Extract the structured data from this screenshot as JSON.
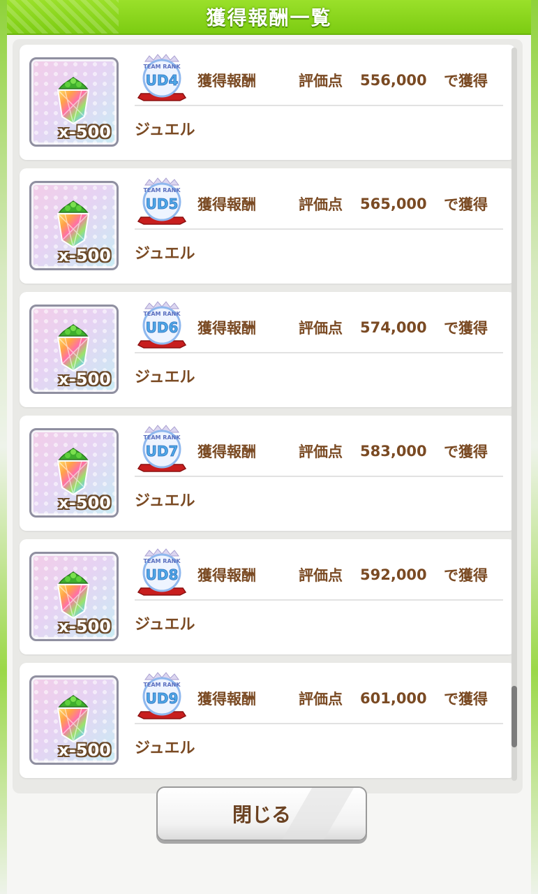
{
  "header": {
    "title": "獲得報酬一覧"
  },
  "rewards": [
    {
      "rank": "UD4",
      "badge_top": "TEAM RANK",
      "reward_label": "獲得報酬",
      "score_label": "評価点",
      "score": "556,000",
      "suffix": "で獲得",
      "item_name": "ジュエル",
      "qty": "x-500"
    },
    {
      "rank": "UD5",
      "badge_top": "TEAM RANK",
      "reward_label": "獲得報酬",
      "score_label": "評価点",
      "score": "565,000",
      "suffix": "で獲得",
      "item_name": "ジュエル",
      "qty": "x-500"
    },
    {
      "rank": "UD6",
      "badge_top": "TEAM RANK",
      "reward_label": "獲得報酬",
      "score_label": "評価点",
      "score": "574,000",
      "suffix": "で獲得",
      "item_name": "ジュエル",
      "qty": "x-500"
    },
    {
      "rank": "UD7",
      "badge_top": "TEAM RANK",
      "reward_label": "獲得報酬",
      "score_label": "評価点",
      "score": "583,000",
      "suffix": "で獲得",
      "item_name": "ジュエル",
      "qty": "x-500"
    },
    {
      "rank": "UD8",
      "badge_top": "TEAM RANK",
      "reward_label": "獲得報酬",
      "score_label": "評価点",
      "score": "592,000",
      "suffix": "で獲得",
      "item_name": "ジュエル",
      "qty": "x-500"
    },
    {
      "rank": "UD9",
      "badge_top": "TEAM RANK",
      "reward_label": "獲得報酬",
      "score_label": "評価点",
      "score": "601,000",
      "suffix": "で獲得",
      "item_name": "ジュエル",
      "qty": "x-500"
    }
  ],
  "scroll": {
    "position": 0.95
  },
  "footer": {
    "close_label": "閉じる"
  },
  "colors": {
    "header": "#7ccc12",
    "text_brown": "#7a4a23",
    "badge_blue": "#4fa8e6",
    "ribbon_red": "#c81e1e"
  },
  "icons": {
    "item": "rainbow-jewel-icon",
    "badge": "team-rank-badge-icon"
  }
}
